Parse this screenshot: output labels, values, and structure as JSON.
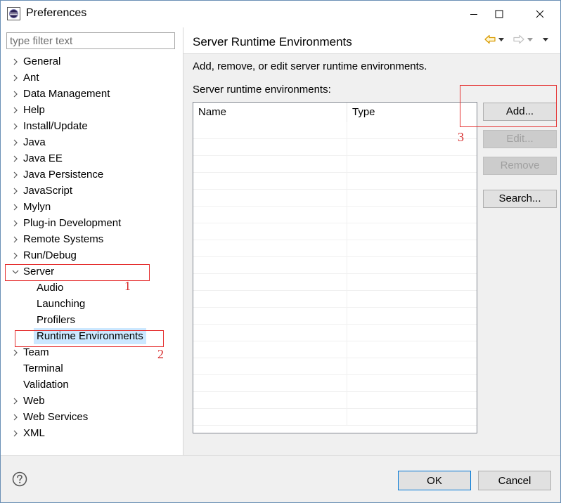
{
  "window": {
    "title": "Preferences",
    "minimize_glyph": "—",
    "maximize_glyph": "☐",
    "close_glyph": "✕"
  },
  "filter": {
    "placeholder": "type filter text",
    "value": ""
  },
  "tree": {
    "items": [
      {
        "label": "General",
        "expanded": false
      },
      {
        "label": "Ant",
        "expanded": false
      },
      {
        "label": "Data Management",
        "expanded": false
      },
      {
        "label": "Help",
        "expanded": false
      },
      {
        "label": "Install/Update",
        "expanded": false
      },
      {
        "label": "Java",
        "expanded": false
      },
      {
        "label": "Java EE",
        "expanded": false
      },
      {
        "label": "Java Persistence",
        "expanded": false
      },
      {
        "label": "JavaScript",
        "expanded": false
      },
      {
        "label": "Mylyn",
        "expanded": false
      },
      {
        "label": "Plug-in Development",
        "expanded": false
      },
      {
        "label": "Remote Systems",
        "expanded": false
      },
      {
        "label": "Run/Debug",
        "expanded": false
      },
      {
        "label": "Server",
        "expanded": true
      },
      {
        "label": "Audio",
        "child": true
      },
      {
        "label": "Launching",
        "child": true
      },
      {
        "label": "Profilers",
        "child": true
      },
      {
        "label": "Runtime Environments",
        "child": true,
        "selected": true
      },
      {
        "label": "Team",
        "expanded": false
      },
      {
        "label": "Terminal",
        "leaf": true
      },
      {
        "label": "Validation",
        "leaf": true
      },
      {
        "label": "Web",
        "expanded": false
      },
      {
        "label": "Web Services",
        "expanded": false
      },
      {
        "label": "XML",
        "expanded": false
      }
    ]
  },
  "page": {
    "title": "Server Runtime Environments",
    "description": "Add, remove, or edit server runtime environments.",
    "list_label": "Server runtime environments:",
    "columns": [
      "Name",
      "Type"
    ],
    "buttons": {
      "add": "Add...",
      "edit": "Edit...",
      "remove": "Remove",
      "search": "Search..."
    }
  },
  "footer": {
    "ok": "OK",
    "cancel": "Cancel"
  },
  "annotations": [
    "1",
    "2",
    "3"
  ],
  "colors": {
    "selection": "#cce8ff",
    "annotation": "#e53030",
    "focus_border": "#0078d7",
    "nav_back": "#e0a000"
  }
}
